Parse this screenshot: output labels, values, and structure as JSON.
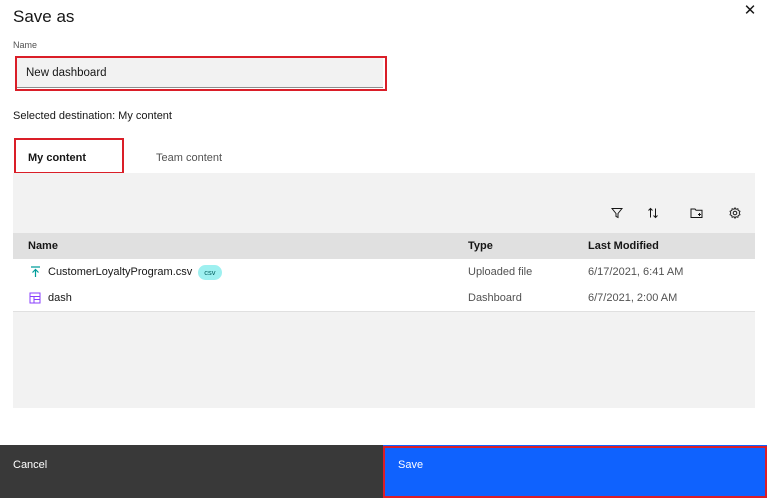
{
  "dialog": {
    "title": "Save as",
    "name_label": "Name",
    "name_value": "New dashboard",
    "destination_text": "Selected destination: My content"
  },
  "tabs": [
    {
      "label": "My content",
      "active": true
    },
    {
      "label": "Team content",
      "active": false
    }
  ],
  "toolbar": {
    "icons": [
      "filter-icon",
      "sort-icon",
      "new-folder-icon",
      "settings-icon"
    ]
  },
  "table": {
    "columns": [
      "Name",
      "Type",
      "Last Modified"
    ],
    "rows": [
      {
        "name": "CustomerLoyaltyProgram.csv",
        "tag": "csv",
        "icon": "upload-icon",
        "type": "Uploaded file",
        "modified": "6/17/2021, 6:41 AM"
      },
      {
        "name": "dash",
        "icon": "dashboard-icon",
        "type": "Dashboard",
        "modified": "6/7/2021, 2:00 AM"
      }
    ]
  },
  "footer": {
    "cancel_label": "Cancel",
    "save_label": "Save"
  },
  "colors": {
    "accent": "#0f62fe",
    "highlight": "#da1e28",
    "csv_tag": "#9ef0f0",
    "cancel_bg": "#393939"
  }
}
